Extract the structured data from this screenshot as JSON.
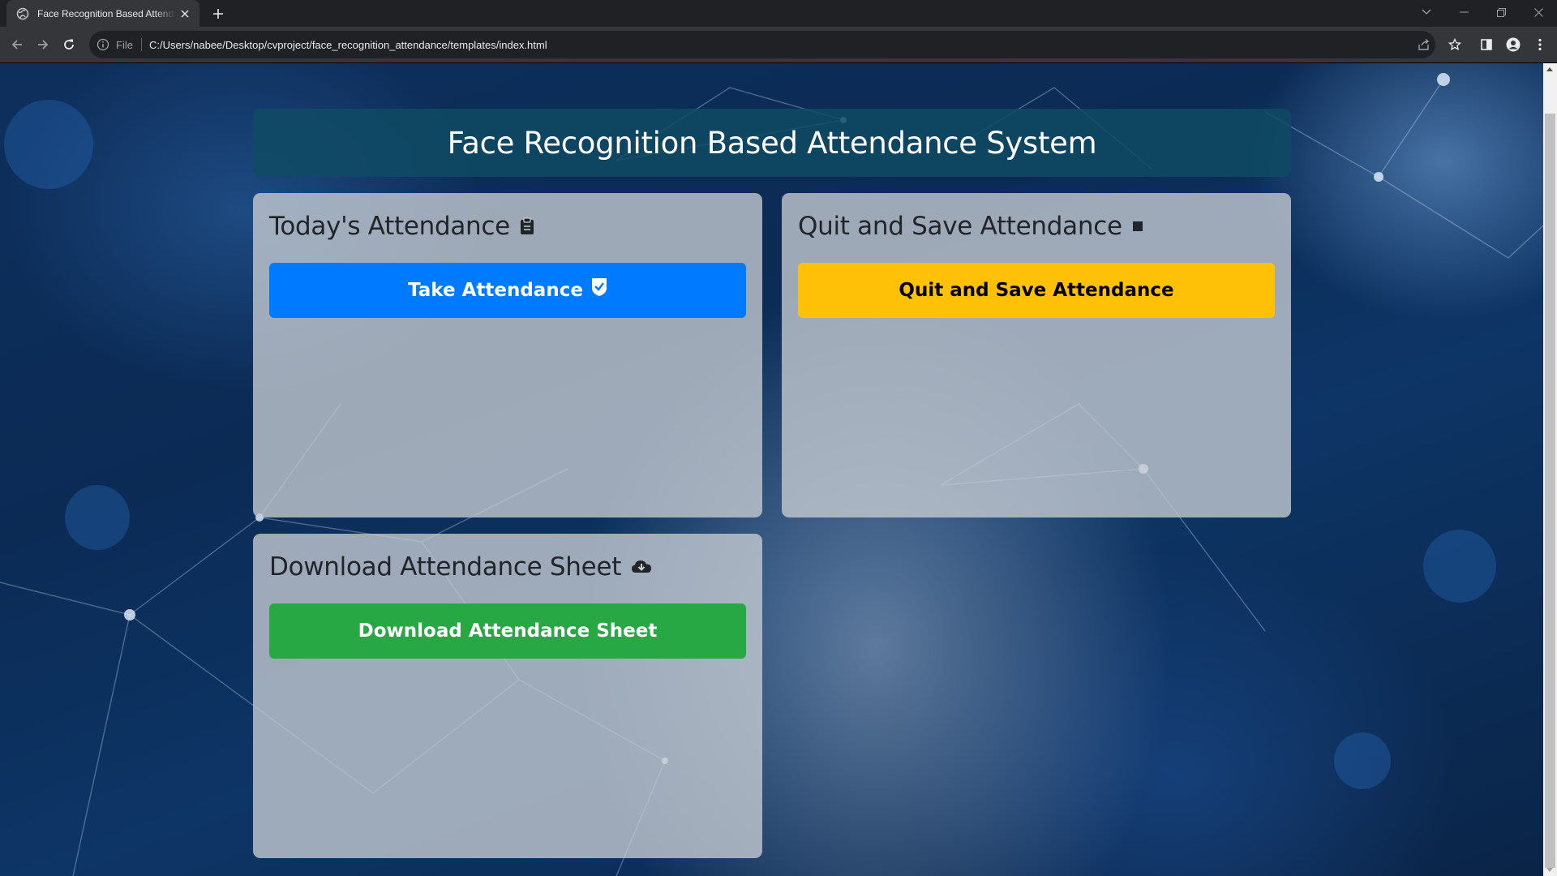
{
  "browser": {
    "tab_title": "Face Recognition Based Attendance System",
    "omnibox": {
      "scheme_label": "File",
      "url": "C:/Users/nabee/Desktop/cvproject/face_recognition_attendance/templates/index.html"
    }
  },
  "page": {
    "header_title": "Face Recognition Based Attendance System",
    "cards": {
      "today": {
        "heading": "Today's Attendance",
        "icon": "clipboard-icon",
        "button_label": "Take Attendance",
        "button_icon": "shield-check-icon",
        "button_color": "#007bff"
      },
      "quit": {
        "heading": "Quit and Save Attendance",
        "icon": "stop-square-icon",
        "button_label": "Quit and Save Attendance",
        "button_color": "#ffc107"
      },
      "download": {
        "heading": "Download Attendance Sheet",
        "icon": "cloud-download-icon",
        "button_label": "Download Attendance Sheet",
        "button_color": "#28a745"
      }
    }
  }
}
